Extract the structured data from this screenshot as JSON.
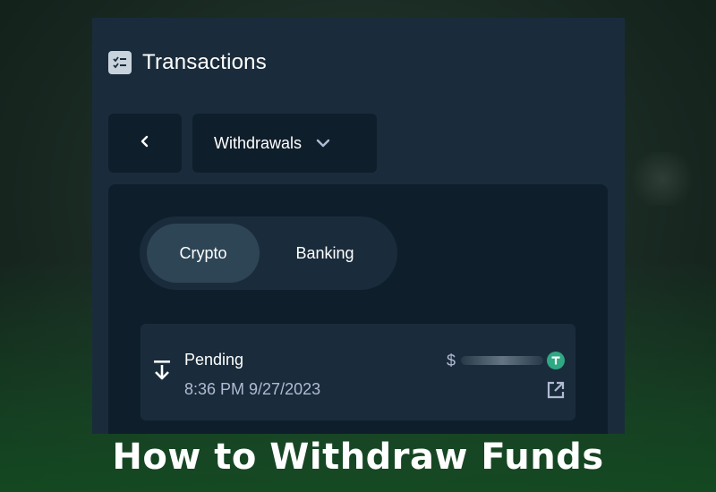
{
  "header": {
    "title": "Transactions",
    "icon": "checklist-icon"
  },
  "nav": {
    "back_icon": "chevron-left-icon",
    "dropdown_label": "Withdrawals",
    "dropdown_icon": "chevron-down-icon"
  },
  "tabs": {
    "options": [
      "Crypto",
      "Banking"
    ],
    "active": "Crypto"
  },
  "transaction": {
    "status": "Pending",
    "datetime": "8:36 PM 9/27/2023",
    "currency_symbol": "$",
    "amount_hidden": true,
    "coin_icon": "tether-icon",
    "direction_icon": "withdraw-arrow-icon",
    "link_icon": "external-link-icon"
  },
  "caption": "How to Withdraw Funds",
  "colors": {
    "panel": "#1a2c3b",
    "dark_surface": "#0f1e2b",
    "active_tab": "#2e4556",
    "muted_text": "#b1bad3",
    "tether": "#2fa883"
  }
}
